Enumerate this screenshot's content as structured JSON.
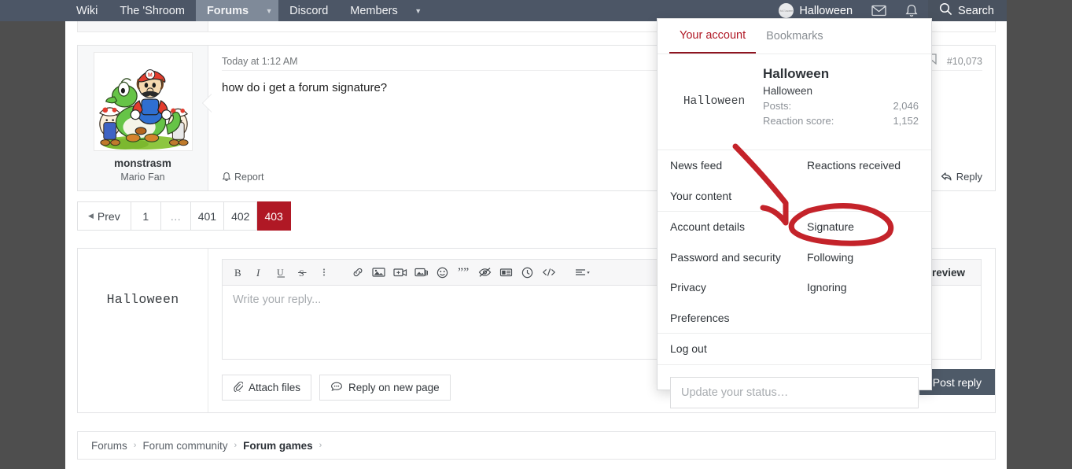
{
  "navbar": {
    "items": [
      {
        "label": "Wiki",
        "active": false,
        "caret": false
      },
      {
        "label": "The 'Shroom",
        "active": false,
        "caret": false
      },
      {
        "label": "Forums",
        "active": true,
        "caret": true
      },
      {
        "label": "Discord",
        "active": false,
        "caret": false
      },
      {
        "label": "Members",
        "active": false,
        "caret": true
      }
    ],
    "username": "Halloween",
    "avatar_text": "Halloween",
    "inbox_icon": "envelope-icon",
    "alerts_icon": "bell-icon",
    "search_label": "Search",
    "search_icon": "search-icon"
  },
  "post": {
    "author": "monstrasm",
    "author_title": "Mario Fan",
    "date": "Today at 1:12 AM",
    "post_number": "#10,073",
    "message": "how do i get a forum signature?",
    "report_label": "Report",
    "report_icon": "bell-icon",
    "reply_label": "Reply",
    "reply_icon": "reply-arrow-icon",
    "bookmark_icon": "bookmark-icon"
  },
  "pagination": {
    "prev_label": "Prev",
    "pages": [
      "1",
      "…",
      "401",
      "402",
      "403"
    ],
    "current": "403"
  },
  "editor": {
    "avatar_text": "Halloween",
    "placeholder": "Write your reply...",
    "preview_label": "Preview",
    "attach_label": "Attach files",
    "attach_icon": "paperclip-icon",
    "newpage_label": "Reply on new page",
    "newpage_icon": "speech-bubble-icon",
    "post_reply_label": "Post reply",
    "toolbar_icons": [
      "bold-icon",
      "italic-icon",
      "underline-icon",
      "strikethrough-icon",
      "more-options-icon",
      "link-icon",
      "image-icon",
      "video-icon",
      "media-gallery-icon",
      "emoji-icon",
      "quote-icon",
      "spoiler-icon",
      "inline-spoiler-icon",
      "clock-icon",
      "code-icon",
      "align-icon"
    ]
  },
  "breadcrumb": {
    "items": [
      "Forums",
      "Forum community",
      "Forum games"
    ],
    "current": "Forum games",
    "separator": "›"
  },
  "account_menu": {
    "tabs": [
      {
        "label": "Your account",
        "active": true
      },
      {
        "label": "Bookmarks",
        "active": false
      }
    ],
    "avatar_text": "Halloween",
    "name": "Halloween",
    "username": "Halloween",
    "stats": [
      {
        "key": "Posts:",
        "value": "2,046"
      },
      {
        "key": "Reaction score:",
        "value": "1,152"
      }
    ],
    "items": [
      {
        "label": "News feed",
        "col": "left"
      },
      {
        "label": "Reactions received",
        "col": "right"
      },
      {
        "label": "Your content",
        "col": "left"
      },
      {
        "label": "",
        "col": "right"
      },
      {
        "label": "Account details",
        "col": "left"
      },
      {
        "label": "Signature",
        "col": "right"
      },
      {
        "label": "Password and security",
        "col": "left"
      },
      {
        "label": "Following",
        "col": "right"
      },
      {
        "label": "Privacy",
        "col": "left"
      },
      {
        "label": "Ignoring",
        "col": "right"
      },
      {
        "label": "Preferences",
        "col": "left"
      },
      {
        "label": "",
        "col": "right"
      },
      {
        "label": "Log out",
        "col": "left"
      },
      {
        "label": "",
        "col": "right"
      }
    ],
    "status_placeholder": "Update your status…"
  },
  "annotation": {
    "color": "#c4232a",
    "shapes": "arrow-pointing-to-signature-and-ellipse-around-signature",
    "target": "Signature"
  },
  "colors": {
    "navbar_bg": "#4c5666",
    "nav_active": "#7f8a99",
    "accent_red": "#b01825",
    "page_bg": "#4e4e4e",
    "button_dark": "#4e5a68",
    "annotation_red": "#c4232a"
  }
}
